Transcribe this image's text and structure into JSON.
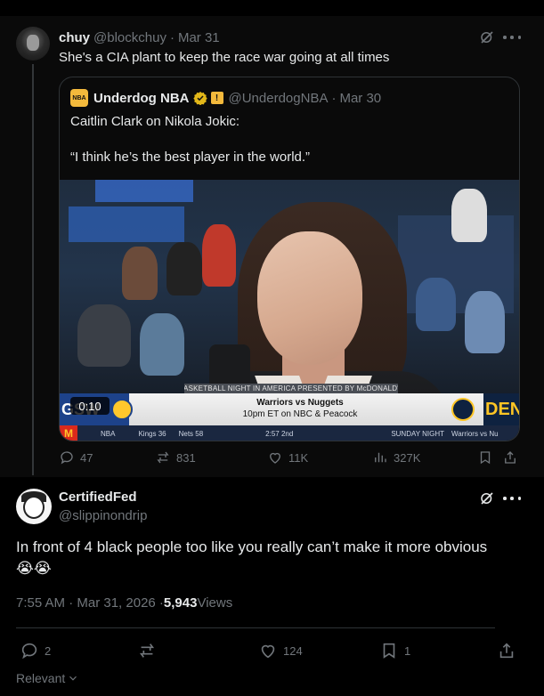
{
  "parent_tweet": {
    "display_name": "chuy",
    "handle": "@blockchuy",
    "separator": "·",
    "date": "Mar 31",
    "text": "She's a CIA plant to keep the race war going at all times",
    "quote": {
      "logo_text": "NBA",
      "display_name": "Underdog NBA",
      "handle": "@UnderdogNBA",
      "separator": "·",
      "date": "Mar 30",
      "line1": "Caitlin Clark on Nikola Jokic:",
      "line2": "“I think he’s the best player in the world.”",
      "video": {
        "duration": "0:10",
        "banner_top": "BASKETBALL NIGHT IN AMERICA PRESENTED BY McDONALD'S",
        "banner_title": "Warriors vs Nuggets",
        "banner_sub": "10pm ET on NBC & Peacock",
        "left_team": "GSW",
        "right_team": "DEN",
        "ticker_league": "NBA",
        "ticker_score_a": "Kings  36",
        "ticker_score_b": "Nets  58",
        "ticker_clock": "2:57  2nd",
        "ticker_right": "SUNDAY NIGHT",
        "ticker_right2": "Warriors vs Nu"
      }
    },
    "stats": {
      "replies": "47",
      "reposts": "831",
      "likes": "11K",
      "views": "327K"
    }
  },
  "main_tweet": {
    "display_name": "CertifiedFed",
    "handle": "@slippinondrip",
    "text": "In front of 4 black people too like you really can’t make it more obvious",
    "emoji": "😭😭",
    "timestamp": "7:55 AM · Mar 31, 2026 · ",
    "views_count": "5,943",
    "views_label": " Views",
    "stats": {
      "replies": "2",
      "likes": "124",
      "bookmarks": "1"
    }
  },
  "sort_label": "Relevant",
  "colors": {
    "text_primary": "#e7e9ea",
    "text_muted": "#71767b",
    "border": "#2f3336",
    "verified_gold": "#e2b719"
  }
}
